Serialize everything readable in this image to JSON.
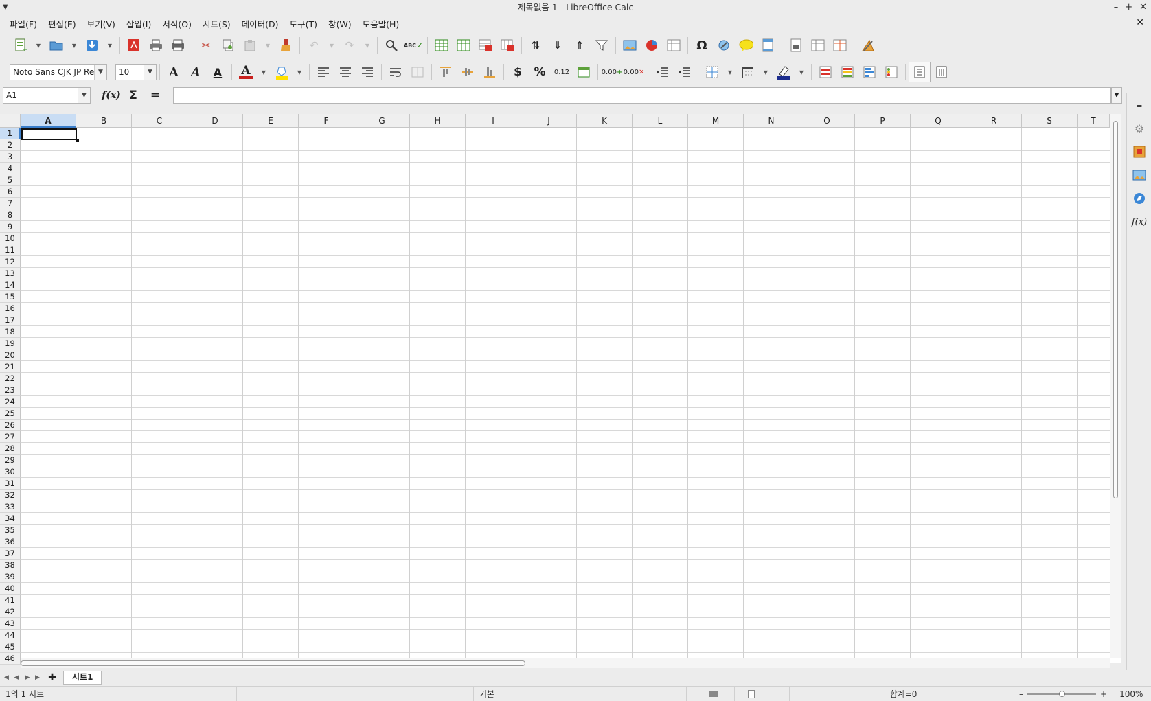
{
  "window": {
    "title": "제목없음 1 - LibreOffice Calc"
  },
  "menu": [
    "파일(F)",
    "편집(E)",
    "보기(V)",
    "삽입(I)",
    "서식(O)",
    "시트(S)",
    "데이터(D)",
    "도구(T)",
    "창(W)",
    "도움말(H)"
  ],
  "format_bar": {
    "font_name": "Noto Sans CJK JP Reg",
    "font_size": "10",
    "number_decimal_label": "0.12",
    "add_decimal_label": "0.00",
    "del_decimal_label": "0.00",
    "currency_label": "$",
    "percent_label": "%"
  },
  "formula_bar": {
    "name_box": "A1",
    "formula": ""
  },
  "columns": [
    "A",
    "B",
    "C",
    "D",
    "E",
    "F",
    "G",
    "H",
    "I",
    "J",
    "K",
    "L",
    "M",
    "N",
    "O",
    "P",
    "Q",
    "R",
    "S",
    "T"
  ],
  "rows": [
    "1",
    "2",
    "3",
    "4",
    "5",
    "6",
    "7",
    "8",
    "9",
    "10",
    "11",
    "12",
    "13",
    "14",
    "15",
    "16",
    "17",
    "18",
    "19",
    "20",
    "21",
    "22",
    "23",
    "24",
    "25",
    "26",
    "27",
    "28",
    "29",
    "30",
    "31",
    "32",
    "33",
    "34",
    "35",
    "36",
    "37",
    "38",
    "39",
    "40",
    "41",
    "42",
    "43",
    "44",
    "45",
    "46"
  ],
  "selected_cell": {
    "column": "A",
    "row": "1"
  },
  "sheet_tabs": [
    "시트1"
  ],
  "status": {
    "sheet_info": "1의 1 시트",
    "page_style": "기본",
    "sum": "합계=0",
    "zoom": "100%"
  }
}
